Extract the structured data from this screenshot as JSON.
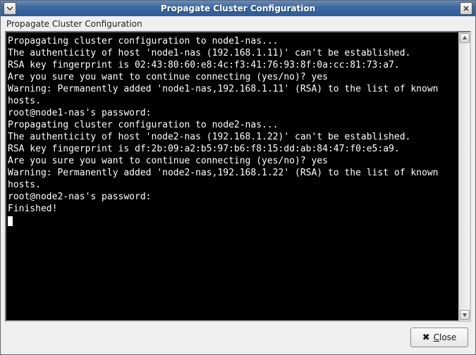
{
  "window": {
    "title": "Propagate Cluster Configuration"
  },
  "frame": {
    "label": "Propagate Cluster Configuration"
  },
  "terminal": {
    "lines": [
      "Propagating cluster configuration to node1-nas...",
      "The authenticity of host 'node1-nas (192.168.1.11)' can't be established.",
      "RSA key fingerprint is 02:43:80:60:e8:4c:f3:41:76:93:8f:0a:cc:81:73:a7.",
      "Are you sure you want to continue connecting (yes/no)? yes",
      "Warning: Permanently added 'node1-nas,192.168.1.11' (RSA) to the list of known hosts.",
      "root@node1-nas's password:",
      "Propagating cluster configuration to node2-nas...",
      "The authenticity of host 'node2-nas (192.168.1.22)' can't be established.",
      "RSA key fingerprint is df:2b:09:a2:b5:97:b6:f8:15:dd:ab:84:47:f0:e5:a9.",
      "Are you sure you want to continue connecting (yes/no)? yes",
      "Warning: Permanently added 'node2-nas,192.168.1.22' (RSA) to the list of known hosts.",
      "root@node2-nas's password:",
      "Finished!"
    ]
  },
  "buttons": {
    "close_mnemonic": "C",
    "close_rest": "lose"
  }
}
